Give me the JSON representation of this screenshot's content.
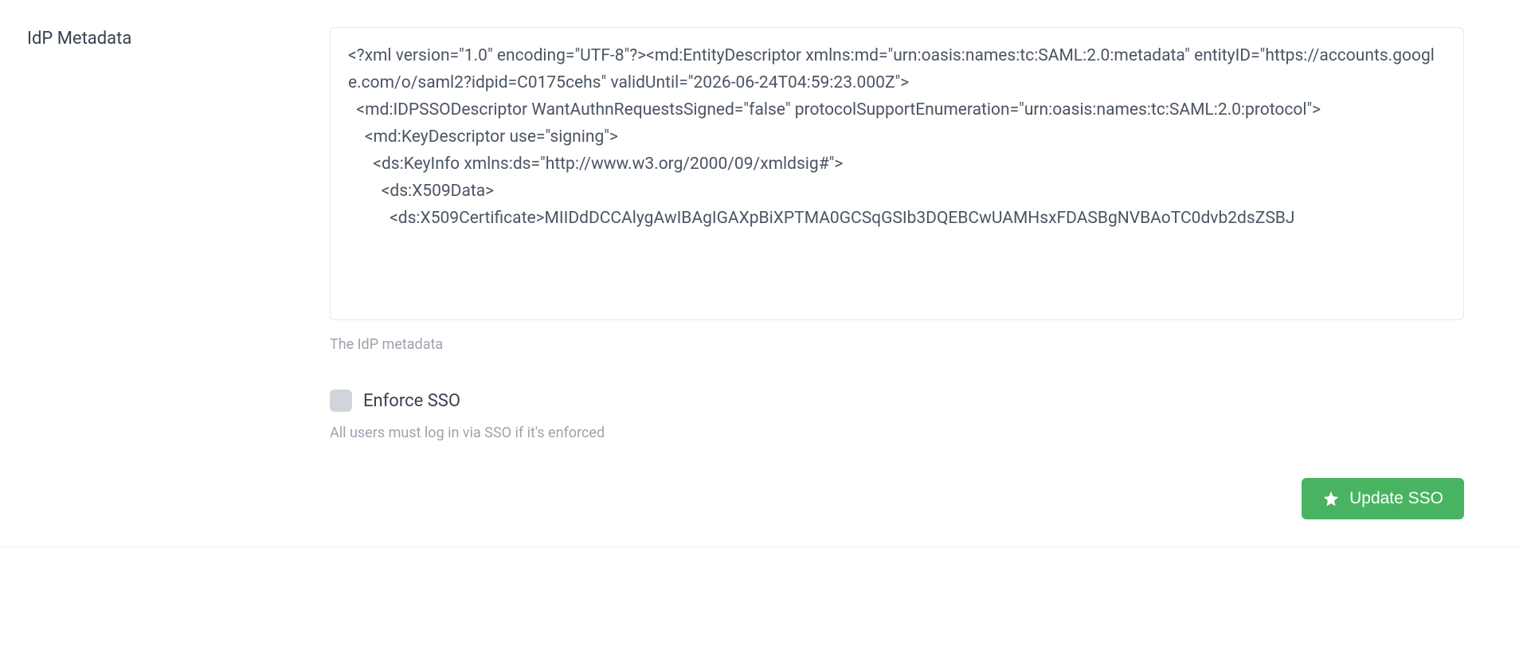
{
  "form": {
    "idp_metadata": {
      "label": "IdP Metadata",
      "value": "<?xml version=\"1.0\" encoding=\"UTF-8\"?><md:EntityDescriptor xmlns:md=\"urn:oasis:names:tc:SAML:2.0:metadata\" entityID=\"https://accounts.google.com/o/saml2?idpid=C0175cehs\" validUntil=\"2026-06-24T04:59:23.000Z\">\n  <md:IDPSSODescriptor WantAuthnRequestsSigned=\"false\" protocolSupportEnumeration=\"urn:oasis:names:tc:SAML:2.0:protocol\">\n    <md:KeyDescriptor use=\"signing\">\n      <ds:KeyInfo xmlns:ds=\"http://www.w3.org/2000/09/xmldsig#\">\n        <ds:X509Data>\n          <ds:X509Certificate>MIIDdDCCAlygAwIBAgIGAXpBiXPTMA0GCSqGSIb3DQEBCwUAMHsxFDASBgNVBAoTC0dvb2dsZSBJ",
      "help": "The IdP metadata"
    },
    "enforce_sso": {
      "label": "Enforce SSO",
      "help": "All users must log in via SSO if it's enforced",
      "checked": false
    },
    "submit_label": "Update SSO"
  }
}
